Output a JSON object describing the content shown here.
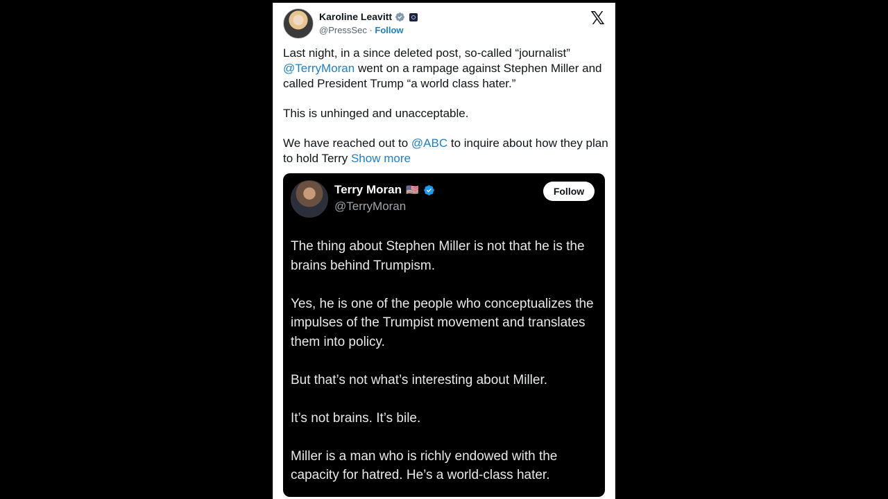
{
  "post": {
    "author_name": "Karoline Leavitt",
    "author_handle": "@PressSec",
    "separator": " · ",
    "follow_label": "Follow",
    "x_logo": "𝕏",
    "text": {
      "p1_a": "Last night, in a since deleted post, so-called “journalist” ",
      "p1_mention": "@TerryMoran",
      "p1_b": " went on a rampage against Stephen Miller and called President Trump “a world class hater.”",
      "p2": "This is unhinged and unacceptable.",
      "p3_a": "We have reached out to ",
      "p3_mention": "@ABC",
      "p3_b": " to inquire about how they plan to hold Terry ",
      "show_more": "Show more"
    }
  },
  "quoted": {
    "author_name": "Terry Moran",
    "flag": "🇺🇸",
    "author_handle": "@TerryMoran",
    "follow_label": "Follow",
    "paragraphs": [
      "The thing about Stephen Miller is not that he is the brains behind Trumpism.",
      "Yes, he is one of the people who conceptualizes the impulses of the Trumpist movement and translates them into policy.",
      "But that’s not what’s interesting about Miller.",
      "It’s not brains. It’s bile.",
      "Miller is a man who is richly endowed with the capacity for hatred. He’s a world-class hater."
    ]
  },
  "colors": {
    "background": "#000000",
    "card": "#ffffff",
    "link": "#1d7fc9",
    "quote_bg": "#000000",
    "verified_blue": "#1d9bf0",
    "verified_gray": "#829aab"
  },
  "icons": {
    "gray_badge": "verified-gray-icon",
    "gov_badge": "government-badge-icon",
    "blue_badge": "verified-blue-icon",
    "logo": "x-logo-icon"
  }
}
